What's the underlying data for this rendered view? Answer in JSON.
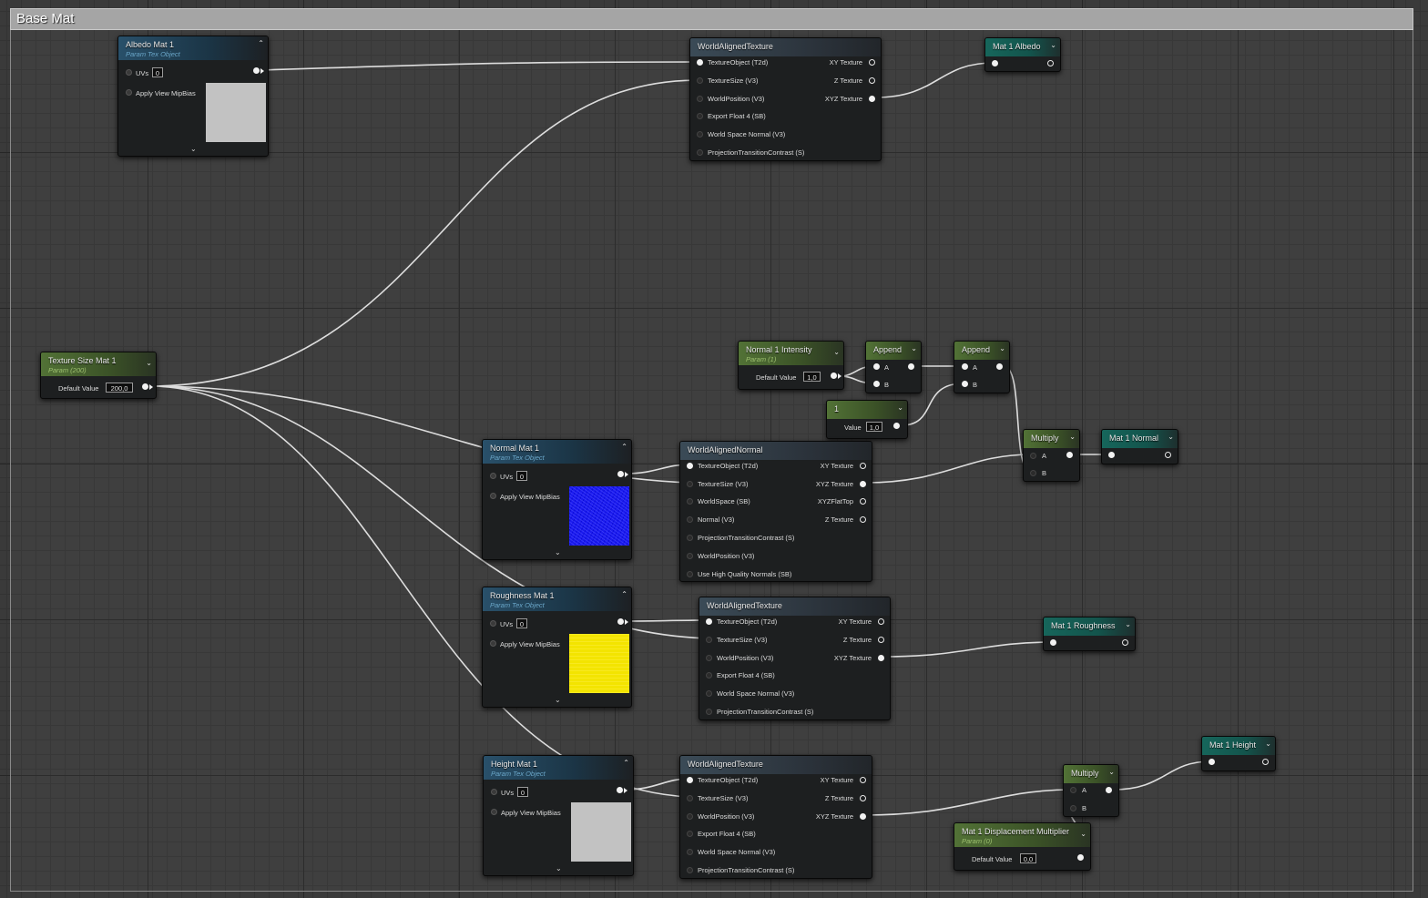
{
  "comment": {
    "title": "Base Mat"
  },
  "albedo_param": {
    "title": "Albedo Mat 1",
    "subtitle": "Param Tex Object",
    "uvs_label": "UVs",
    "uvs_value": "0",
    "mip_label": "Apply View MipBias"
  },
  "wat1": {
    "title": "WorldAlignedTexture",
    "inputs": [
      "TextureObject (T2d)",
      "TextureSize (V3)",
      "WorldPosition (V3)",
      "Export Float 4 (SB)",
      "World Space Normal (V3)",
      "ProjectionTransitionContrast (S)"
    ],
    "outputs": [
      "XY Texture",
      "Z Texture",
      "XYZ Texture"
    ]
  },
  "out_albedo": {
    "title": "Mat 1 Albedo"
  },
  "texsize": {
    "title": "Texture Size Mat 1",
    "subtitle": "Param (200)",
    "default_label": "Default Value",
    "default_value": "200,0"
  },
  "normal_intensity": {
    "title": "Normal 1 Intensity",
    "subtitle": "Param (1)",
    "default_label": "Default Value",
    "default_value": "1,0"
  },
  "append1": {
    "title": "Append",
    "a": "A",
    "b": "B"
  },
  "append2": {
    "title": "Append",
    "a": "A",
    "b": "B"
  },
  "constant": {
    "title": "1",
    "value_label": "Value",
    "value": "1,0"
  },
  "multiply1": {
    "title": "Multiply",
    "a": "A",
    "b": "B"
  },
  "out_normal": {
    "title": "Mat 1 Normal"
  },
  "normal_param": {
    "title": "Normal Mat 1",
    "subtitle": "Param Tex Object",
    "uvs_label": "UVs",
    "uvs_value": "0",
    "mip_label": "Apply View MipBias"
  },
  "wan": {
    "title": "WorldAlignedNormal",
    "inputs": [
      "TextureObject (T2d)",
      "TextureSize (V3)",
      "WorldSpace (SB)",
      "Normal (V3)",
      "ProjectionTransitionContrast (S)",
      "WorldPosition (V3)",
      "Use High Quality Normals (SB)"
    ],
    "outputs": [
      "XY Texture",
      "XYZ Texture",
      "XYZFlatTop",
      "Z Texture"
    ]
  },
  "rough_param": {
    "title": "Roughness  Mat 1",
    "subtitle": "Param Tex Object",
    "uvs_label": "UVs",
    "uvs_value": "0",
    "mip_label": "Apply View MipBias"
  },
  "wat2": {
    "title": "WorldAlignedTexture",
    "inputs": [
      "TextureObject (T2d)",
      "TextureSize (V3)",
      "WorldPosition (V3)",
      "Export Float 4 (SB)",
      "World Space Normal (V3)",
      "ProjectionTransitionContrast (S)"
    ],
    "outputs": [
      "XY Texture",
      "Z Texture",
      "XYZ Texture"
    ]
  },
  "out_rough": {
    "title": "Mat 1 Roughness"
  },
  "height_param": {
    "title": "Height  Mat 1",
    "subtitle": "Param Tex Object",
    "uvs_label": "UVs",
    "uvs_value": "0",
    "mip_label": "Apply View MipBias"
  },
  "wat3": {
    "title": "WorldAlignedTexture",
    "inputs": [
      "TextureObject (T2d)",
      "TextureSize (V3)",
      "WorldPosition (V3)",
      "Export Float 4 (SB)",
      "World Space Normal (V3)",
      "ProjectionTransitionContrast (S)"
    ],
    "outputs": [
      "XY Texture",
      "Z Texture",
      "XYZ Texture"
    ]
  },
  "multiply2": {
    "title": "Multiply",
    "a": "A",
    "b": "B"
  },
  "out_height": {
    "title": "Mat 1 Height"
  },
  "disp_mult": {
    "title": "Mat 1 Displacement Multiplier",
    "subtitle": "Param (0)",
    "default_label": "Default Value",
    "default_value": "0,0"
  },
  "colors": {
    "wire": "#e6e6e6",
    "param_blue": "#29506a",
    "param_green": "#527236",
    "output_teal": "#16665b",
    "preview_normal": "#1a1aee",
    "preview_rough": "#f3e400",
    "preview_grey": "#c2c2c2"
  }
}
